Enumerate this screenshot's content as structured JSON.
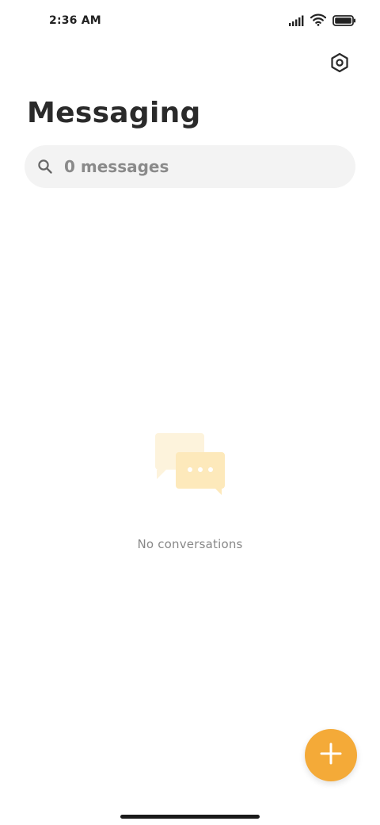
{
  "status_bar": {
    "time": "2:36 AM",
    "icons": [
      "signal-icon",
      "wifi-icon",
      "battery-icon"
    ]
  },
  "header": {
    "title": "Messaging",
    "settings_icon": "settings-icon"
  },
  "search": {
    "placeholder": "0 messages",
    "icon": "search-icon"
  },
  "empty_state": {
    "illustration": "chat-bubbles-icon",
    "text": "No conversations"
  },
  "fab": {
    "icon": "plus-icon"
  },
  "colors": {
    "accent": "#f4aa38",
    "illustration_light": "#fdf3dc",
    "illustration_main": "#fde9bb",
    "search_bg": "#f3f3f3",
    "title": "#2a2a2a",
    "muted_text": "#888888"
  }
}
